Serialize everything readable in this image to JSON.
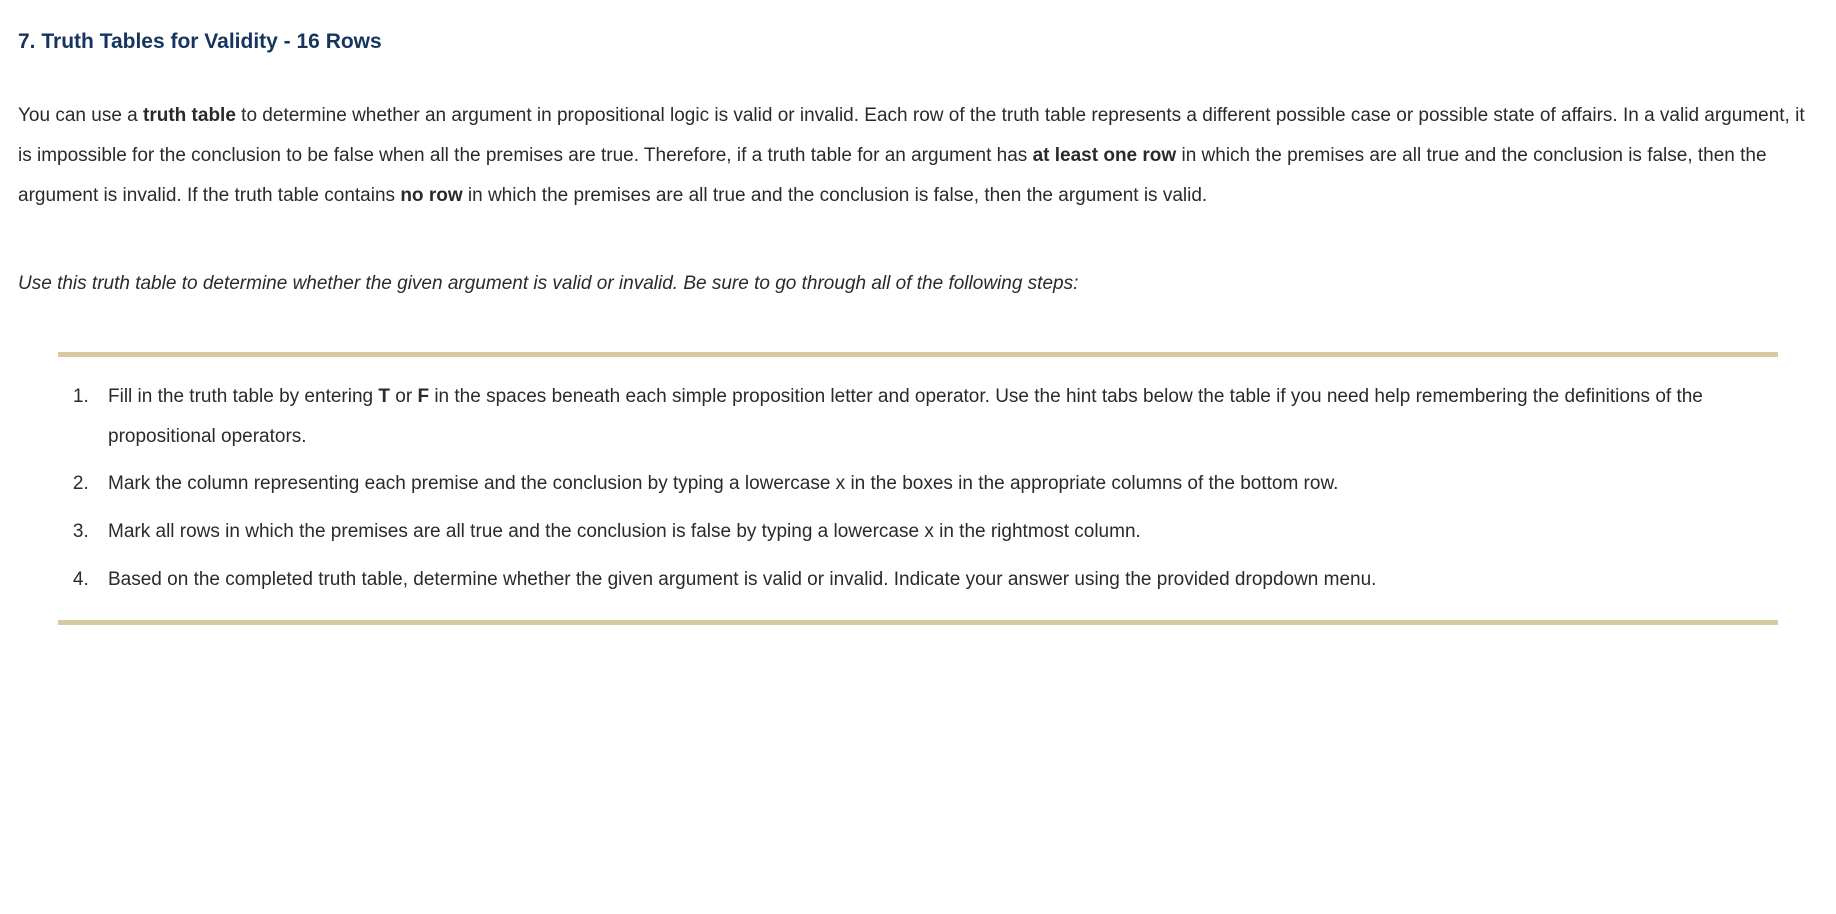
{
  "heading": "7. Truth Tables for Validity - 16 Rows",
  "intro": {
    "part1": "You can use a ",
    "bold1": "truth table",
    "part2": " to determine whether an argument in propositional logic is valid or invalid. Each row of the truth table represents a different possible case or possible state of affairs. In a valid argument, it is impossible for the conclusion to be false when all the premises are true. Therefore, if a truth table for an argument has ",
    "bold2": "at least one row",
    "part3": " in which the premises are all true and the conclusion is false, then the argument is invalid. If the truth table contains ",
    "bold3": "no row",
    "part4": " in which the premises are all true and the conclusion is false, then the argument is valid."
  },
  "instructions_lead": "Use this truth table to determine whether the given argument is valid or invalid. Be sure to go through all of the following steps:",
  "steps": [
    {
      "text_before": "Fill in the truth table by entering ",
      "bold1": "T",
      "mid1": " or ",
      "bold2": "F",
      "text_after": " in the spaces beneath each simple proposition letter and operator. Use the hint tabs below the table if you need help remembering the definitions of the propositional operators."
    },
    {
      "text": "Mark the column representing each premise and the conclusion by typing a lowercase x in the boxes in the appropriate columns of the bottom row."
    },
    {
      "text": "Mark all rows in which the premises are all true and the conclusion is false by typing a lowercase x in the rightmost column."
    },
    {
      "text": "Based on the completed truth table, determine whether the given argument is valid or invalid. Indicate your answer using the provided dropdown menu."
    }
  ]
}
